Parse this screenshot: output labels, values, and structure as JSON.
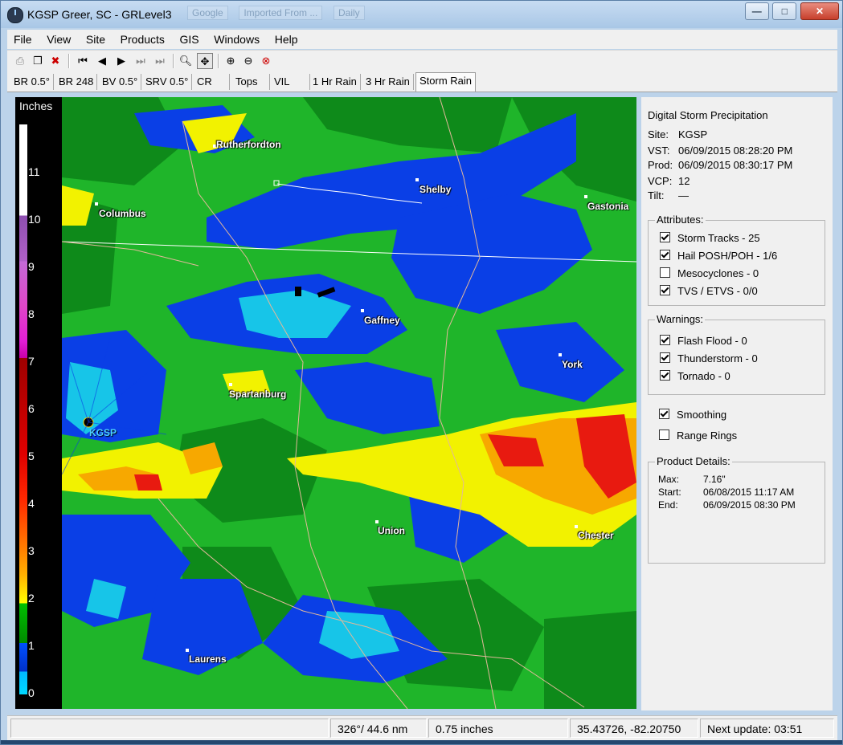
{
  "window": {
    "title": "KGSP Greer, SC - GRLevel3",
    "ghost_tabs": [
      "Google",
      "Imported From ...",
      "Daily"
    ]
  },
  "window_controls": {
    "minimize": "—",
    "maximize": "□",
    "close": "✕"
  },
  "menu": [
    "File",
    "View",
    "Site",
    "Products",
    "GIS",
    "Windows",
    "Help"
  ],
  "toolbar_icons": [
    "print-icon",
    "copy-icon",
    "cancel-icon",
    "first-frame-icon",
    "prev-frame-icon",
    "play-icon",
    "next-frame-icon",
    "last-frame-icon",
    "zoom-icon",
    "pan-icon",
    "zoom-in-icon",
    "zoom-out-icon",
    "zoom-reset-icon"
  ],
  "product_tabs": [
    "BR 0.5°",
    "BR 248",
    "BV 0.5°",
    "SRV 0.5°",
    "CR",
    "Tops",
    "VIL",
    "1 Hr Rain",
    "3 Hr Rain",
    "Storm Rain"
  ],
  "selected_tab": "Storm Rain",
  "legend": {
    "title": "Inches",
    "labels": [
      "11",
      "10",
      "9",
      "8",
      "7",
      "6",
      "5",
      "4",
      "3",
      "2",
      "1",
      "0"
    ]
  },
  "map": {
    "radar_site": "KGSP",
    "cities": [
      "Rutherfordton",
      "Shelby",
      "Gastonia",
      "Columbus",
      "Gaffney",
      "York",
      "Spartanburg",
      "Union",
      "Chester",
      "Laurens"
    ]
  },
  "info": {
    "title": "Digital Storm Precipitation",
    "site_label": "Site:",
    "site": "KGSP",
    "vst_label": "VST:",
    "vst": "06/09/2015  08:28:20 PM",
    "prod_label": "Prod:",
    "prod": "06/09/2015  08:30:17 PM",
    "vcp_label": "VCP:",
    "vcp": "12",
    "tilt_label": "Tilt:",
    "tilt": "—"
  },
  "attributes": {
    "label": "Attributes:",
    "items": [
      {
        "label": "Storm Tracks - 25",
        "checked": true
      },
      {
        "label": "Hail POSH/POH - 1/6",
        "checked": true
      },
      {
        "label": "Mesocyclones - 0",
        "checked": false
      },
      {
        "label": "TVS / ETVS - 0/0",
        "checked": true
      }
    ]
  },
  "warnings": {
    "label": "Warnings:",
    "items": [
      {
        "label": "Flash Flood - 0",
        "checked": true
      },
      {
        "label": "Thunderstorm - 0",
        "checked": true
      },
      {
        "label": "Tornado - 0",
        "checked": true
      }
    ]
  },
  "options": {
    "smoothing": {
      "label": "Smoothing",
      "checked": true
    },
    "range_rings": {
      "label": "Range Rings",
      "checked": false
    }
  },
  "details": {
    "label": "Product Details:",
    "max_label": "Max:",
    "max": "7.16\"",
    "start_label": "Start:",
    "start": "06/08/2015  11:17 AM",
    "end_label": "End:",
    "end": "06/09/2015  08:30 PM"
  },
  "status": {
    "azimuth": "326°/ 44.6 nm",
    "value": "0.75 inches",
    "coords": "35.43726, -82.20750",
    "next_update": "Next update: 03:51"
  }
}
